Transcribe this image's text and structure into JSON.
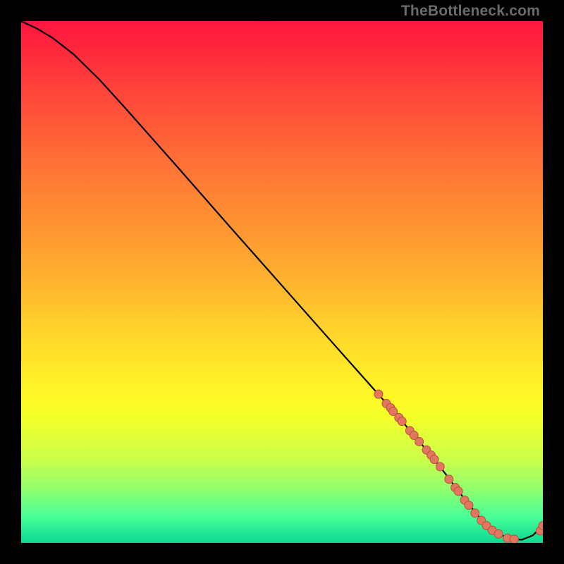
{
  "watermark": "TheBottleneck.com",
  "colors": {
    "curve": "#000000",
    "dot_fill": "#e2765f",
    "dot_stroke": "#b9503c"
  },
  "chart_data": {
    "type": "line",
    "title": "",
    "xlabel": "",
    "ylabel": "",
    "xlim": [
      0,
      100
    ],
    "ylim": [
      0,
      100
    ],
    "grid": false,
    "legend": false,
    "series": [
      {
        "name": "bottleneck-curve",
        "x": [
          0,
          3,
          6,
          10,
          15,
          20,
          30,
          40,
          50,
          60,
          68,
          72,
          76,
          80,
          83,
          86,
          88,
          90,
          92,
          94,
          96,
          98,
          100
        ],
        "y": [
          100,
          98.6,
          96.8,
          93.7,
          88.8,
          83.3,
          72.0,
          60.6,
          49.3,
          38.0,
          29.0,
          24.5,
          19.8,
          15.0,
          11.0,
          7.1,
          4.7,
          2.8,
          1.5,
          0.7,
          0.6,
          1.4,
          3.2
        ]
      }
    ],
    "scatter_points": {
      "name": "sample-dots",
      "x": [
        68.5,
        70.0,
        70.8,
        71.3,
        72.4,
        73.0,
        74.5,
        75.3,
        76.3,
        77.7,
        78.6,
        79.2,
        80.3,
        82.0,
        83.2,
        83.8,
        85.0,
        85.8,
        87.0,
        88.2,
        89.2,
        90.3,
        91.5,
        93.2,
        94.5,
        99.5,
        100.0
      ],
      "y": [
        28.5,
        26.7,
        25.9,
        25.2,
        24.0,
        23.3,
        21.5,
        20.6,
        19.4,
        17.8,
        16.8,
        16.0,
        14.6,
        12.2,
        10.6,
        9.9,
        8.2,
        7.2,
        5.7,
        4.3,
        3.3,
        2.4,
        1.7,
        0.9,
        0.7,
        2.3,
        3.3
      ]
    }
  }
}
